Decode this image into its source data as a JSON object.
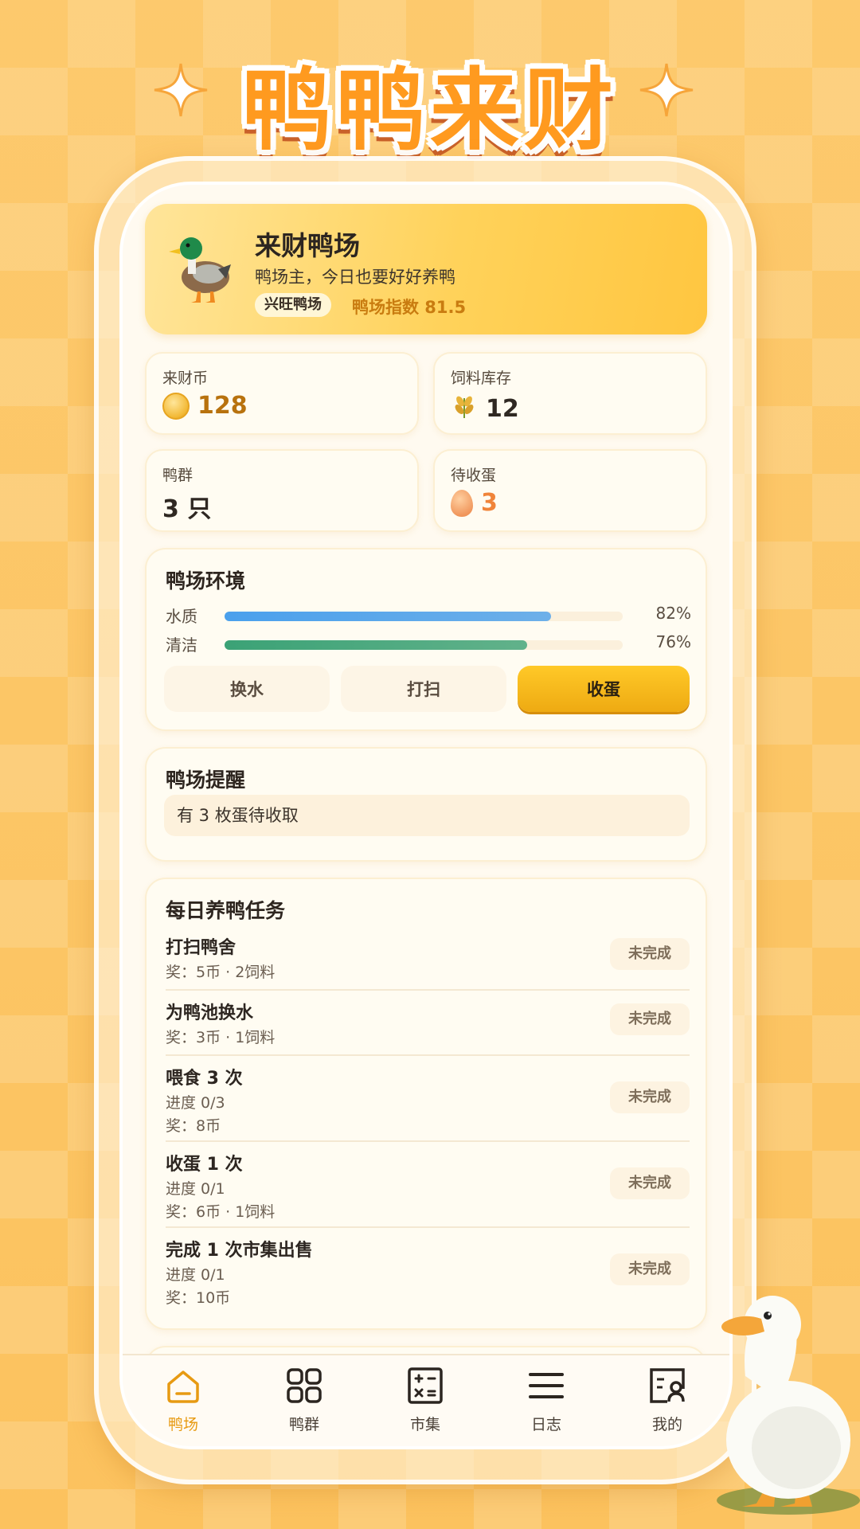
{
  "app_title": "鸭鸭来财",
  "farm": {
    "name": "来财鸭场",
    "subtitle": "鸭场主，今日也要好好养鸭",
    "badge": "兴旺鸭场",
    "index_text": "鸭场指数 81.5"
  },
  "stats": {
    "coins": {
      "label": "来财币",
      "value": "128"
    },
    "feed": {
      "label": "饲料库存",
      "value": "12"
    },
    "ducks": {
      "label": "鸭群",
      "value": "3 只"
    },
    "eggs": {
      "label": "待收蛋",
      "value": "3"
    }
  },
  "environment": {
    "title": "鸭场环境",
    "metrics": [
      {
        "name": "水质",
        "percent": "82%",
        "level": 0.82,
        "color": "#4aa0ec"
      },
      {
        "name": "清洁",
        "percent": "76%",
        "level": 0.76,
        "color": "#3ba276"
      }
    ],
    "buttons": {
      "change_water": "换水",
      "clean": "打扫",
      "collect_eggs": "收蛋"
    }
  },
  "reminder": {
    "title": "鸭场提醒",
    "message": "有 3 枚蛋待收取"
  },
  "tasks": {
    "title": "每日养鸭任务",
    "items": [
      {
        "name": "打扫鸭舍",
        "lines": [
          "奖：5币 · 2饲料"
        ],
        "status": "未完成"
      },
      {
        "name": "为鸭池换水",
        "lines": [
          "奖：3币 · 1饲料"
        ],
        "status": "未完成"
      },
      {
        "name": "喂食 3 次",
        "lines": [
          "进度 0/3",
          "奖：8币"
        ],
        "status": "未完成"
      },
      {
        "name": "收蛋 1 次",
        "lines": [
          "进度 0/1",
          "奖：6币 · 1饲料"
        ],
        "status": "未完成"
      },
      {
        "name": "完成 1 次市集出售",
        "lines": [
          "进度 0/1",
          "奖：10币"
        ],
        "status": "未完成"
      }
    ]
  },
  "nav": {
    "items": [
      {
        "label": "鸭场",
        "icon": "home-icon",
        "active": true
      },
      {
        "label": "鸭群",
        "icon": "grid-icon",
        "active": false
      },
      {
        "label": "市集",
        "icon": "calculator-icon",
        "active": false
      },
      {
        "label": "日志",
        "icon": "menu-icon",
        "active": false
      },
      {
        "label": "我的",
        "icon": "profile-icon",
        "active": false
      }
    ]
  },
  "colors": {
    "accent": "#f0a818",
    "background": "#fcc35f",
    "active_nav": "#e79a12"
  }
}
